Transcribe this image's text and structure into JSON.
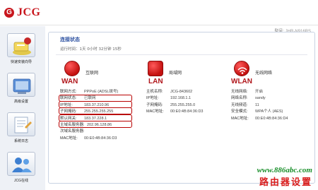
{
  "brand": {
    "logo_mark": "G",
    "name": "JCG"
  },
  "model": {
    "label": "型号:",
    "value": "JHR-N916RS"
  },
  "sidebar": {
    "items": [
      {
        "label": "快速安装向导",
        "icon": "wizard-icon"
      },
      {
        "label": "高级设置",
        "icon": "advanced-settings-icon"
      },
      {
        "label": "系统日志",
        "icon": "system-log-icon"
      },
      {
        "label": "JCG在线",
        "icon": "jcg-online-icon"
      }
    ]
  },
  "status": {
    "title": "连接状态",
    "uptime": "运行时间：1天 0小时 32分钟 15秒"
  },
  "wan": {
    "name": "WAN",
    "cn": "互联网",
    "rows": [
      {
        "k": "联网方式:",
        "v": "PPPoE (ADSL拨号)"
      },
      {
        "k": "联网状态:",
        "v": "已联网"
      },
      {
        "k": "IP地址:",
        "v": "183.37.210.96"
      },
      {
        "k": "子网掩码:",
        "v": "255.255.255.255"
      },
      {
        "k": "默认网关:",
        "v": "183.37.228.1"
      },
      {
        "k": "主域名服务器:",
        "v": "202.96.128.86"
      },
      {
        "k": "次域名服务器:",
        "v": ""
      },
      {
        "k": "MAC地址:",
        "v": "00:E0:4B:84:36:D3"
      }
    ]
  },
  "lan": {
    "name": "LAN",
    "cn": "局域网",
    "rows": [
      {
        "k": "主机名称:",
        "v": "JCG-843602"
      },
      {
        "k": "IP地址:",
        "v": "192.168.1.1"
      },
      {
        "k": "子网掩码:",
        "v": "255.255.255.0"
      },
      {
        "k": "MAC地址:",
        "v": "00:E0:4B:84:36:D3"
      }
    ]
  },
  "wlan": {
    "name": "WLAN",
    "cn": "无线网络",
    "rows": [
      {
        "k": "无线网络:",
        "v": "开启"
      },
      {
        "k": "网络名称:",
        "v": "sandy"
      },
      {
        "k": "无线频道:",
        "v": "11"
      },
      {
        "k": "安全模式:",
        "v": "WPA个人 (AES)"
      },
      {
        "k": "MAC地址:",
        "v": "00:E0:4B:84:36:D4"
      }
    ]
  },
  "watermark": {
    "url": "www.886abc.com",
    "text": "路由器设置"
  },
  "colors": {
    "brand_red": "#c8161d",
    "title_blue": "#2a4fa0",
    "highlight": "#b80000",
    "url_green": "#1a8f2b"
  }
}
